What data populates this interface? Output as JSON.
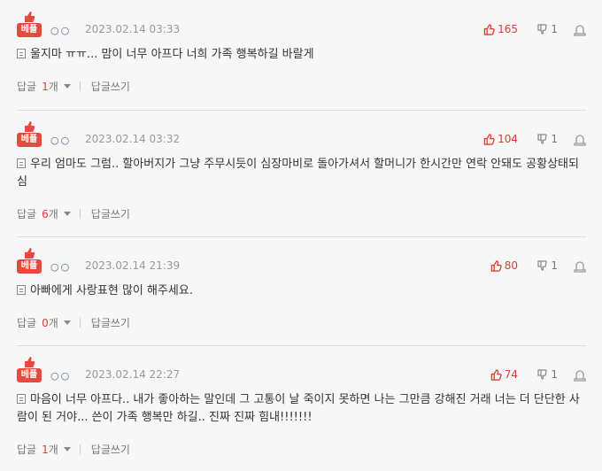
{
  "comments": [
    {
      "badge": "베플",
      "nick": "○○",
      "date": "2023.02.14 03:33",
      "up": "165",
      "down": "1",
      "text": "울지마 ㅠㅠ... 맘이 너무 아프다 너희 가족 행복하길 바랄게",
      "reply_label": "답글",
      "reply_count": "1",
      "reply_unit": "개",
      "write_label": "답글쓰기"
    },
    {
      "badge": "베플",
      "nick": "○○",
      "date": "2023.02.14 03:32",
      "up": "104",
      "down": "1",
      "text": "우리 엄마도 그럼.. 할아버지가 그냥 주무시듯이 심장마비로 돌아가셔서 할머니가 한시간만 연락 안돼도 공황상태되심",
      "reply_label": "답글",
      "reply_count": "6",
      "reply_unit": "개",
      "write_label": "답글쓰기"
    },
    {
      "badge": "베플",
      "nick": "○○",
      "date": "2023.02.14 21:39",
      "up": "80",
      "down": "1",
      "text": "아빠에게 사랑표현 많이 해주세요.",
      "reply_label": "답글",
      "reply_count": "0",
      "reply_unit": "개",
      "write_label": "답글쓰기"
    },
    {
      "badge": "베플",
      "nick": "○○",
      "date": "2023.02.14 22:27",
      "up": "74",
      "down": "1",
      "text": "마음이 너무 아프다.. 내가 좋아하는 말인데 그 고통이 날 죽이지 못하면 나는 그만큼 강해진 거래 너는 더 단단한 사람이 된 거야... 쓴이 가족 행복만 하길.. 진짜 진짜 힘내!!!!!!!",
      "reply_label": "답글",
      "reply_count": "1",
      "reply_unit": "개",
      "write_label": "답글쓰기"
    }
  ],
  "colors": {
    "accent": "#e03c31",
    "badge_bg": "#e8483d",
    "nick": "#5a6a8a"
  },
  "icons": {
    "best": "thumbs-up-icon",
    "up": "thumbs-up-icon",
    "down": "thumbs-down-icon",
    "report": "siren-icon",
    "doc": "document-icon",
    "caret": "caret-down-icon"
  }
}
